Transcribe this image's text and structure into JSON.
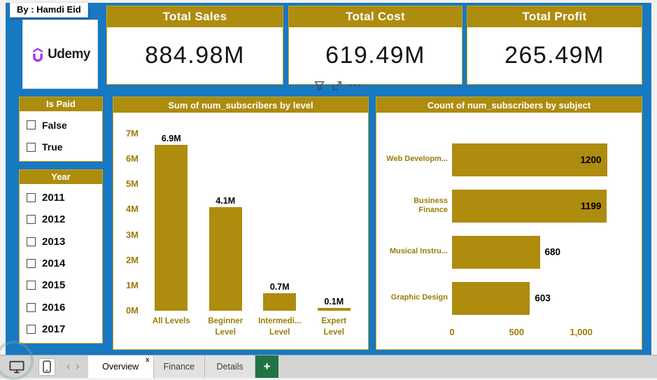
{
  "author": "By : Hamdi Eid",
  "logo": {
    "brand": "Udemy"
  },
  "kpis": [
    {
      "title": "Total Sales",
      "value": "884.98M"
    },
    {
      "title": "Total Cost",
      "value": "619.49M"
    },
    {
      "title": "Total Profit",
      "value": "265.49M"
    }
  ],
  "glyphs": {
    "more_options": "···",
    "scroll_left": "‹",
    "scroll_right": "›",
    "close_tab": "x"
  },
  "slicers": [
    {
      "title": "Is Paid",
      "options": [
        "False",
        "True"
      ]
    },
    {
      "title": "Year",
      "options": [
        "2011",
        "2012",
        "2013",
        "2014",
        "2015",
        "2016",
        "2017"
      ]
    }
  ],
  "chart_data": [
    {
      "type": "bar",
      "orientation": "vertical",
      "title": "Sum of num_subscribers by level",
      "categories": [
        "All Levels",
        "Beginner\nLevel",
        "Intermedi...\nLevel",
        "Expert\nLevel"
      ],
      "values": [
        6900000,
        4100000,
        700000,
        100000
      ],
      "value_labels": [
        "6.9M",
        "4.1M",
        "0.7M",
        "0.1M"
      ],
      "xlabel": "",
      "ylabel": "",
      "ylim": [
        0,
        7000000
      ],
      "yticks": [
        {
          "label": "0M",
          "value": 0
        },
        {
          "label": "1M",
          "value": 1000000
        },
        {
          "label": "2M",
          "value": 2000000
        },
        {
          "label": "3M",
          "value": 3000000
        },
        {
          "label": "4M",
          "value": 4000000
        },
        {
          "label": "5M",
          "value": 5000000
        },
        {
          "label": "6M",
          "value": 6000000
        },
        {
          "label": "7M",
          "value": 7000000
        }
      ],
      "grid": false,
      "legend": false
    },
    {
      "type": "bar",
      "orientation": "horizontal",
      "title": "Count of num_subscribers by subject",
      "categories": [
        "Web Developm...",
        "Business Finance",
        "Musical Instru...",
        "Graphic Design"
      ],
      "values": [
        1200,
        1199,
        680,
        603
      ],
      "xlim": [
        0,
        1300
      ],
      "xticks": [
        {
          "label": "0",
          "value": 0
        },
        {
          "label": "500",
          "value": 500
        },
        {
          "label": "1,000",
          "value": 1000
        }
      ],
      "grid": false,
      "legend": false
    }
  ],
  "statusbar": {
    "tabs": [
      {
        "label": "Overview",
        "active": true,
        "closable": true
      },
      {
        "label": "Finance",
        "active": false,
        "closable": false
      },
      {
        "label": "Details",
        "active": false,
        "closable": false
      }
    ],
    "add_tab": "+"
  },
  "colors": {
    "background": "#1878c2",
    "gold": "#ad8c0e",
    "axis_text": "#9a7d08",
    "tab_green": "#217346",
    "udemy_purple": "#a435f0"
  }
}
